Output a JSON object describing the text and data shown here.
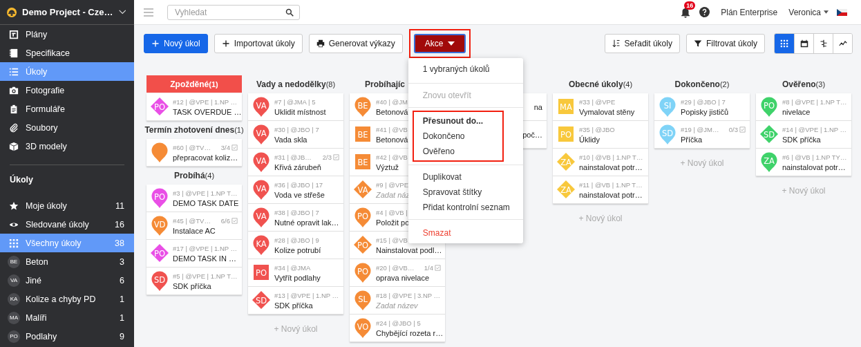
{
  "sidebar": {
    "project": "Demo Project - Cze…",
    "nav": [
      {
        "label": "Plány",
        "selected": false
      },
      {
        "label": "Specifikace",
        "selected": false
      },
      {
        "label": "Úkoly",
        "selected": true
      },
      {
        "label": "Fotografie",
        "selected": false
      },
      {
        "label": "Formuláře",
        "selected": false
      },
      {
        "label": "Soubory",
        "selected": false
      },
      {
        "label": "3D modely",
        "selected": false
      }
    ],
    "section_title": "Úkoly",
    "filters": [
      {
        "kind": "icon",
        "label": "Moje úkoly",
        "count": "11",
        "selected": false
      },
      {
        "kind": "icon",
        "label": "Sledované úkoly",
        "count": "16",
        "selected": false
      },
      {
        "kind": "icon",
        "label": "Všechny úkoly",
        "count": "38",
        "selected": true
      },
      {
        "kind": "tag",
        "tag": "BE",
        "label": "Beton",
        "count": "3",
        "selected": false
      },
      {
        "kind": "tag",
        "tag": "VA",
        "label": "Jiné",
        "count": "6",
        "selected": false
      },
      {
        "kind": "tag",
        "tag": "KA",
        "label": "Kolize a chyby PD",
        "count": "1",
        "selected": false
      },
      {
        "kind": "tag",
        "tag": "MA",
        "label": "Malíři",
        "count": "1",
        "selected": false
      },
      {
        "kind": "tag",
        "tag": "PO",
        "label": "Podlahy",
        "count": "9",
        "selected": false
      }
    ]
  },
  "topbar": {
    "search": {
      "placeholder": "Vyhledat"
    },
    "notifications": "16",
    "plan": "Plán Enterprise",
    "user": "Veronica"
  },
  "toolbar": {
    "buttons": [
      {
        "kind": "primary",
        "label": "Nový úkol"
      },
      {
        "kind": "add",
        "label": "Importovat úkoly"
      },
      {
        "kind": "print",
        "label": "Generovat výkazy"
      }
    ],
    "actions": {
      "label": "Akce",
      "highlighted": true
    },
    "sort": "Seřadit úkoly",
    "filter": "Filtrovat úkoly",
    "views": [
      {
        "selected": true
      },
      {
        "selected": false
      },
      {
        "selected": false
      },
      {
        "selected": false
      }
    ]
  },
  "menu": {
    "items": [
      {
        "kind": "info",
        "label": "1 vybraných úkolů",
        "disabled": false
      },
      {
        "kind": "divider"
      },
      {
        "kind": "action",
        "label": "Znovu otevřít",
        "disabled": true
      },
      {
        "kind": "divider"
      },
      {
        "kind": "group",
        "highlighted": true,
        "items": [
          {
            "kind": "heading",
            "label": "Přesunout do...",
            "disabled": false
          },
          {
            "kind": "action",
            "label": "Dokončeno",
            "disabled": false
          },
          {
            "kind": "action",
            "label": "Ověřeno",
            "disabled": false
          }
        ]
      },
      {
        "kind": "divider"
      },
      {
        "kind": "action",
        "label": "Duplikovat",
        "disabled": false
      },
      {
        "kind": "action",
        "label": "Spravovat štítky",
        "disabled": false
      },
      {
        "kind": "action",
        "label": "Přidat kontrolní seznam",
        "disabled": false
      },
      {
        "kind": "divider"
      },
      {
        "kind": "danger",
        "label": "Smazat",
        "disabled": false
      }
    ]
  },
  "board": {
    "columns": [
      {
        "sections": [
          {
            "title": "Zpožděné",
            "count": "(1)",
            "alert": true,
            "cards": [
              {
                "meta": "#12 | @VPE | 1.NP …",
                "title": "TASK OVERDUE …",
                "marker": {
                  "kind": "diamond",
                  "code": "PO",
                  "color": "#e94fe6"
                }
              }
            ]
          },
          {
            "title": "Termín zhotovení dnes",
            "count": "(1)",
            "alert": false,
            "cards": [
              {
                "meta": "#60 | @TV…",
                "checklist": "3/4",
                "title": "přepracovat koliz…",
                "marker": {
                  "kind": "pin",
                  "color": "#f58b36"
                }
              }
            ]
          },
          {
            "title": "Probíhá",
            "count": "(4)",
            "alert": false,
            "cards": [
              {
                "meta": "#3 | @VPE | 1.NP T…",
                "title": "DEMO TASK DATE",
                "marker": {
                  "kind": "pin",
                  "code": "PO",
                  "color": "#e94fe6"
                }
              },
              {
                "meta": "#45 | @TV…",
                "checklist": "6/6",
                "title": "Instalace AC",
                "marker": {
                  "kind": "pin",
                  "code": "VD",
                  "color": "#f58b36"
                }
              },
              {
                "meta": "#17 | @VPE | 1.NP …",
                "title": "DEMO TASK IN …",
                "marker": {
                  "kind": "diamond",
                  "code": "PO",
                  "color": "#e94fe6"
                }
              },
              {
                "meta": "#5 | @VPE | 1.NP T…",
                "title": "SDK příčka",
                "marker": {
                  "kind": "pin",
                  "code": "SD",
                  "color": "#f0524f"
                }
              }
            ]
          }
        ]
      },
      {
        "add": "+ Nový úkol",
        "sections": [
          {
            "title": "Vady a nedodělky",
            "count": "(8)",
            "alert": false,
            "cards": [
              {
                "meta": "#7 | @JMA | 5",
                "title": "Uklidit místnost",
                "marker": {
                  "kind": "pin",
                  "code": "VA",
                  "color": "#f0524f"
                }
              },
              {
                "meta": "#30 | @JBO | 7",
                "title": "Vada skla",
                "marker": {
                  "kind": "pin",
                  "code": "VA",
                  "color": "#f0524f"
                }
              },
              {
                "meta": "#31 | @JB…",
                "checklist": "2/3",
                "title": "Křivá zárubeň",
                "marker": {
                  "kind": "pin",
                  "code": "VA",
                  "color": "#f0524f"
                }
              },
              {
                "meta": "#36 | @JBO | 17",
                "title": "Voda ve střeše",
                "marker": {
                  "kind": "pin",
                  "code": "VA",
                  "color": "#f0524f"
                }
              },
              {
                "meta": "#38 | @JBO | 7",
                "title": "Nutné opravit lak…",
                "marker": {
                  "kind": "pin",
                  "code": "VA",
                  "color": "#f0524f"
                }
              },
              {
                "meta": "#28 | @JBO | 9",
                "title": "Kolize potrubí",
                "marker": {
                  "kind": "pin",
                  "code": "KA",
                  "color": "#f0524f"
                }
              },
              {
                "meta": "#34 | @JMA",
                "title": "Vytřít podlahy",
                "marker": {
                  "kind": "square",
                  "code": "PO",
                  "color": "#f0524f"
                }
              },
              {
                "meta": "#13 | @VPE | 1.NP …",
                "title": "SDK příčka",
                "marker": {
                  "kind": "diamond",
                  "code": "SD",
                  "color": "#f0524f"
                }
              }
            ]
          }
        ]
      },
      {
        "clipped": true,
        "sections": [
          {
            "title": "Probíhajíc",
            "alert": false,
            "cards": [
              {
                "meta": "#40 | @JM",
                "title": "Betonová",
                "marker": {
                  "kind": "pin",
                  "code": "BE",
                  "color": "#f58b36"
                }
              },
              {
                "meta": "#41 | @VB",
                "title": "Betonová",
                "marker": {
                  "kind": "square",
                  "code": "BE",
                  "color": "#f58b36"
                }
              },
              {
                "meta": "#42 | @VB",
                "title": "Výztuž",
                "marker": {
                  "kind": "square",
                  "code": "BE",
                  "color": "#f58b36"
                }
              },
              {
                "meta": "#9 | @VPE",
                "title": "Zadat náz",
                "untitled": true,
                "marker": {
                  "kind": "diamond",
                  "code": "VA",
                  "color": "#f58b36"
                }
              },
              {
                "meta": "#4 | @VB |",
                "title": "Položit po",
                "marker": {
                  "kind": "pin",
                  "code": "PO",
                  "color": "#f58b36"
                }
              },
              {
                "meta": "#15 | @VB",
                "title": "Nainstalovat podl…",
                "marker": {
                  "kind": "diamond",
                  "code": "PO",
                  "color": "#f58b36"
                }
              },
              {
                "meta": "#20 | @VB…",
                "checklist": "1/4",
                "title": "oprava nivelace",
                "marker": {
                  "kind": "pin",
                  "code": "PO",
                  "color": "#f58b36"
                }
              },
              {
                "meta": "#18 | @VPE | 3.NP …",
                "title": "Zadat název",
                "untitled": true,
                "marker": {
                  "kind": "pin",
                  "code": "SL",
                  "color": "#f58b36"
                }
              },
              {
                "meta": "#24 | @JBO | 5",
                "title": "Chybějící rozeta r…",
                "marker": {
                  "kind": "pin",
                  "code": "VO",
                  "color": "#f58b36"
                }
              }
            ]
          }
        ]
      },
      {
        "covered": true,
        "sections": [
          {
            "cards": [
              {
                "title": "na"
              },
              {
                "title": "poč…"
              }
            ]
          }
        ]
      },
      {
        "add": "+ Nový úkol",
        "sections": [
          {
            "title": "Obecné úkoly",
            "count": "(4)",
            "alert": false,
            "cards": [
              {
                "meta": "#33 | @VPE",
                "title": "Vymalovat stěny",
                "marker": {
                  "kind": "square",
                  "code": "MA",
                  "color": "#f8c83c"
                }
              },
              {
                "meta": "#35 | @JBO",
                "title": "Úklidy",
                "marker": {
                  "kind": "square",
                  "code": "PO",
                  "color": "#f8c83c"
                }
              },
              {
                "meta": "#10 | @VB | 1.NP T…",
                "title": "nainstalovat potr…",
                "marker": {
                  "kind": "diamond",
                  "code": "ZA",
                  "color": "#f8c83c"
                }
              },
              {
                "meta": "#11 | @VB | 1.NP T…",
                "title": "nainstalovat potr…",
                "marker": {
                  "kind": "diamond",
                  "code": "ZA",
                  "color": "#f8c83c"
                }
              }
            ]
          }
        ]
      },
      {
        "add": "+ Nový úkol",
        "sections": [
          {
            "title": "Dokončeno",
            "count": "(2)",
            "alert": false,
            "cards": [
              {
                "meta": "#29 | @JBO | 7",
                "title": "Popisky jističů",
                "marker": {
                  "kind": "pin",
                  "code": "SI",
                  "color": "#7fd3f7"
                }
              },
              {
                "meta": "#19 | @JM…",
                "checklist": "0/3",
                "title": "Příčka",
                "marker": {
                  "kind": "pin",
                  "code": "SD",
                  "color": "#7fd3f7"
                }
              }
            ]
          }
        ]
      },
      {
        "add": "+ Nový úkol",
        "sections": [
          {
            "title": "Ověřeno",
            "count": "(3)",
            "alert": false,
            "cards": [
              {
                "meta": "#8 | @VPE | 1.NP T…",
                "title": "nivelace",
                "marker": {
                  "kind": "pin",
                  "code": "PO",
                  "color": "#3fd26a"
                }
              },
              {
                "meta": "#14 | @VPE | 1.NP …",
                "title": "SDK příčka",
                "marker": {
                  "kind": "diamond",
                  "code": "SD",
                  "color": "#3fd26a"
                }
              },
              {
                "meta": "#6 | @VB | 1.NP TY…",
                "title": "nainstalovat potr…",
                "marker": {
                  "kind": "pin",
                  "code": "ZA",
                  "color": "#3fd26a"
                }
              }
            ]
          }
        ]
      }
    ]
  }
}
